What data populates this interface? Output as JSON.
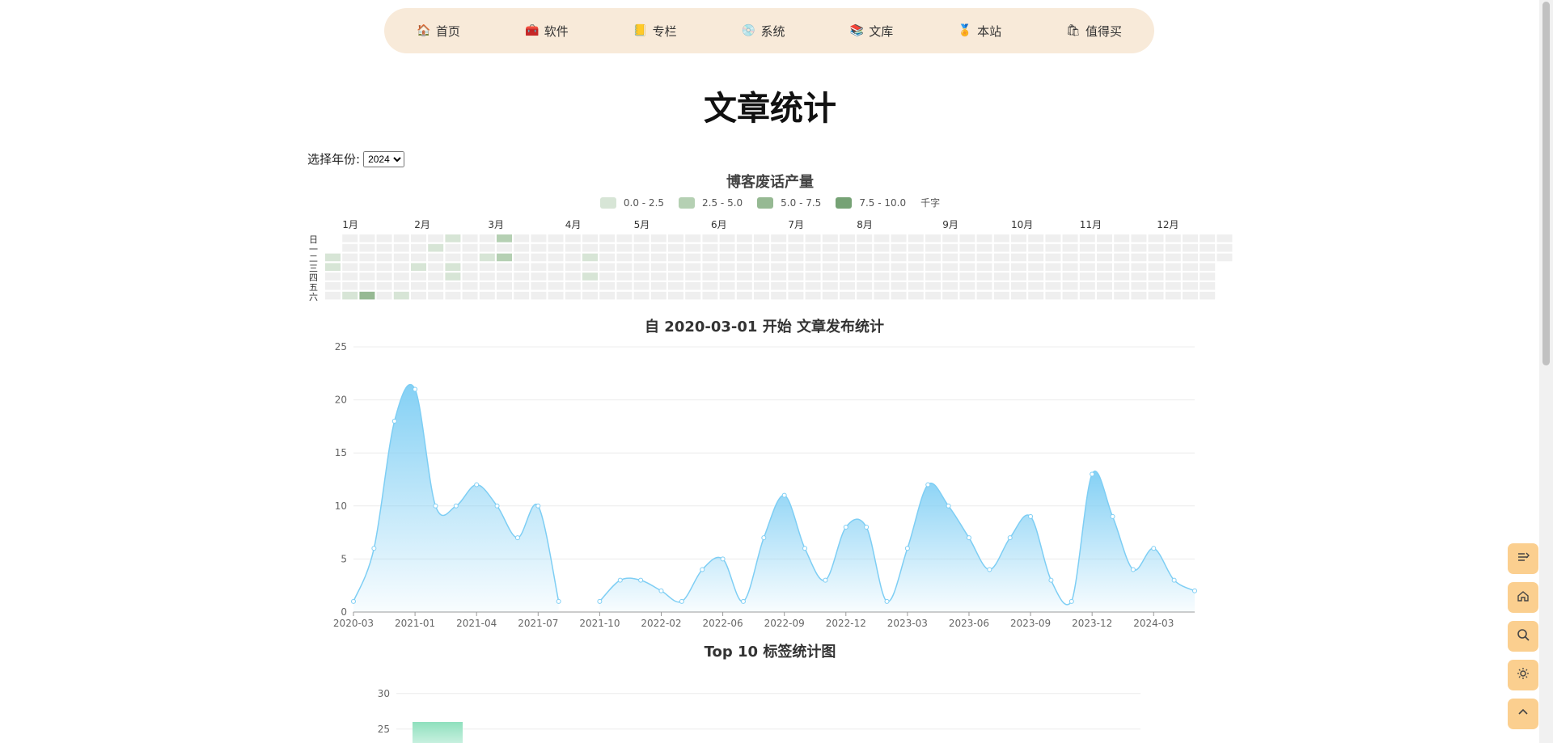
{
  "nav": {
    "items": [
      {
        "label": "首页",
        "icon": "house-icon",
        "glyph": "🏠"
      },
      {
        "label": "软件",
        "icon": "toolbox-icon",
        "glyph": "🧰"
      },
      {
        "label": "专栏",
        "icon": "notebook-icon",
        "glyph": "📒"
      },
      {
        "label": "系统",
        "icon": "disc-icon",
        "glyph": "💿"
      },
      {
        "label": "文库",
        "icon": "books-icon",
        "glyph": "📚"
      },
      {
        "label": "本站",
        "icon": "medal-icon",
        "glyph": "🏅"
      },
      {
        "label": "值得买",
        "icon": "shopping-icon",
        "glyph": "🛍"
      }
    ]
  },
  "page": {
    "title": "文章统计"
  },
  "year_select": {
    "label": "选择年份:",
    "selected": "2024"
  },
  "heatmap": {
    "title": "博客废话产量",
    "legend": [
      {
        "label": "0.0 - 2.5",
        "color": "#d7e5d6"
      },
      {
        "label": "2.5 - 5.0",
        "color": "#b5d0b3"
      },
      {
        "label": "5.0 - 7.5",
        "color": "#96b993"
      },
      {
        "label": "7.5 - 10.0",
        "color": "#76a275"
      }
    ],
    "unit": "千字",
    "months": [
      "1月",
      "2月",
      "3月",
      "4月",
      "5月",
      "6月",
      "7月",
      "8月",
      "9月",
      "10月",
      "11月",
      "12月"
    ],
    "weekdays": [
      "日",
      "一",
      "二",
      "三",
      "四",
      "五",
      "六"
    ],
    "empty_color": "#efefef",
    "cells": [
      {
        "week": 1,
        "day": 6,
        "level": 1
      },
      {
        "week": 2,
        "day": 6,
        "level": 3
      },
      {
        "week": 4,
        "day": 6,
        "level": 1
      },
      {
        "week": 5,
        "day": 3,
        "level": 1
      },
      {
        "week": 6,
        "day": 1,
        "level": 1
      },
      {
        "week": 7,
        "day": 0,
        "level": 1
      },
      {
        "week": 7,
        "day": 3,
        "level": 1
      },
      {
        "week": 7,
        "day": 4,
        "level": 1
      },
      {
        "week": 9,
        "day": 2,
        "level": 1
      },
      {
        "week": 10,
        "day": 0,
        "level": 2
      },
      {
        "week": 10,
        "day": 2,
        "level": 2
      },
      {
        "week": 0,
        "day": 2,
        "level": 1
      },
      {
        "week": 0,
        "day": 3,
        "level": 1
      },
      {
        "week": 15,
        "day": 2,
        "level": 1
      },
      {
        "week": 15,
        "day": 4,
        "level": 1
      }
    ]
  },
  "chart_data": [
    {
      "type": "area",
      "title": "自 2020-03-01 开始 文章发布统计",
      "xlabel": "",
      "ylabel": "",
      "ylim": [
        0,
        25
      ],
      "y_ticks": [
        "0",
        "5",
        "10",
        "15",
        "20",
        "25"
      ],
      "x_tick_labels": [
        "2020-03",
        "2021-01",
        "2021-04",
        "2021-07",
        "2021-10",
        "2022-02",
        "2022-06",
        "2022-09",
        "2022-12",
        "2023-03",
        "2023-06",
        "2023-09",
        "2023-12",
        "2024-03"
      ],
      "x_tick_index": [
        0,
        3,
        6,
        9,
        12,
        15,
        18,
        21,
        24,
        27,
        30,
        33,
        36,
        39
      ],
      "values": [
        1,
        6,
        18,
        21,
        10,
        10,
        12,
        10,
        7,
        10,
        1,
        null,
        1,
        3,
        3,
        2,
        1,
        4,
        5,
        1,
        7,
        11,
        6,
        3,
        8,
        8,
        1,
        6,
        12,
        10,
        7,
        4,
        7,
        9,
        3,
        1,
        13,
        9,
        4,
        6,
        3,
        2
      ],
      "color": "#7ecef4"
    },
    {
      "type": "bar",
      "title": "Top 10 标签统计图",
      "y_ticks": [
        "25",
        "30"
      ],
      "ylim_visible": [
        22,
        31
      ],
      "values": [
        26
      ],
      "color": "#8ee0bd"
    }
  ],
  "tools": [
    {
      "icon": "menu-icon"
    },
    {
      "icon": "home-icon"
    },
    {
      "icon": "search-icon"
    },
    {
      "icon": "sun-icon"
    },
    {
      "icon": "chevron-up-icon"
    }
  ]
}
